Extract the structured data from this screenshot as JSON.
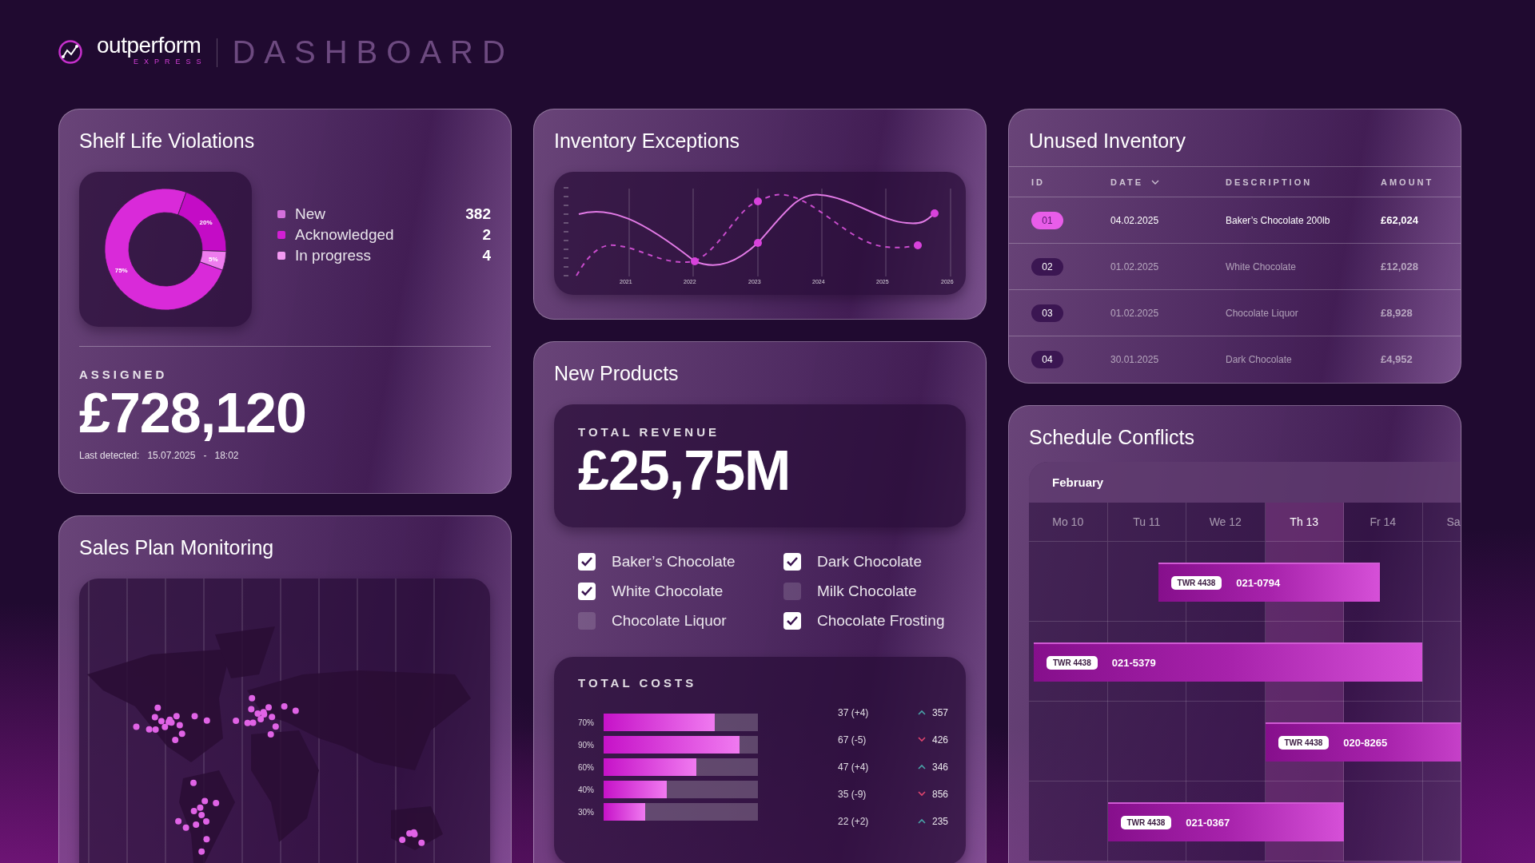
{
  "header": {
    "brand": "outperform",
    "brand_sub": "EXPRESS",
    "title": "DASHBOARD"
  },
  "shelf_life": {
    "title": "Shelf Life Violations",
    "chart_data": {
      "type": "donut",
      "values": [
        75,
        20,
        5
      ],
      "value_labels": [
        "75%",
        "20%",
        "5%"
      ]
    },
    "legend": [
      {
        "label": "New",
        "count": "382",
        "color": "#d46fdc"
      },
      {
        "label": "Acknowledged",
        "count": "2",
        "color": "#d21fd4"
      },
      {
        "label": "In progress",
        "count": "4",
        "color": "#f39af3"
      }
    ],
    "assigned_label": "ASSIGNED",
    "assigned_value": "£728,120",
    "detected_label": "Last detected:",
    "detected_date": "15.07.2025",
    "detected_sep": "-",
    "detected_time": "18:02"
  },
  "sales_plan": {
    "title": "Sales Plan Monitoring"
  },
  "inventory_exceptions": {
    "title": "Inventory Exceptions",
    "x_labels": [
      "2021",
      "2022",
      "2023",
      "2024",
      "2025",
      "2026"
    ]
  },
  "new_products": {
    "title": "New Products",
    "revenue_label": "TOTAL REVENUE",
    "revenue_value": "£25,75M",
    "products": [
      {
        "label": "Baker’s Chocolate",
        "checked": true
      },
      {
        "label": "Dark Chocolate",
        "checked": true
      },
      {
        "label": "White Chocolate",
        "checked": true
      },
      {
        "label": "Milk Chocolate",
        "checked": false
      },
      {
        "label": "Chocolate Liquor",
        "checked": false
      },
      {
        "label": "Chocolate Frosting",
        "checked": true
      }
    ],
    "costs": {
      "title": "TOTAL COSTS",
      "bars": [
        {
          "label": "70%",
          "level": 0.72
        },
        {
          "label": "90%",
          "level": 0.88
        },
        {
          "label": "60%",
          "level": 0.6
        },
        {
          "label": "40%",
          "level": 0.41
        },
        {
          "label": "30%",
          "level": 0.27
        }
      ],
      "stats": [
        {
          "value": "37 (+4)",
          "kind": "up",
          "total": "357"
        },
        {
          "value": "67 (-5)",
          "kind": "down",
          "total": "426"
        },
        {
          "value": "47 (+4)",
          "kind": "up",
          "total": "346"
        },
        {
          "value": "35 (-9)",
          "kind": "down",
          "total": "856"
        },
        {
          "value": "22 (+2)",
          "kind": "up",
          "total": "235"
        }
      ]
    }
  },
  "unused_inventory": {
    "title": "Unused Inventory",
    "columns": [
      {
        "label": "ID",
        "sortable": false
      },
      {
        "label": "DATE",
        "sortable": true
      },
      {
        "label": "DESCRIPTION",
        "sortable": false
      },
      {
        "label": "AMOUNT",
        "sortable": false
      }
    ],
    "rows": [
      {
        "id": "01",
        "date": "04.02.2025",
        "description": "Baker’s Chocolate 200lb",
        "amount": "£62,024",
        "selected": true
      },
      {
        "id": "02",
        "date": "01.02.2025",
        "description": "White Chocolate",
        "amount": "£12,028",
        "selected": false
      },
      {
        "id": "03",
        "date": "01.02.2025",
        "description": "Chocolate Liquor",
        "amount": "£8,928",
        "selected": false
      },
      {
        "id": "04",
        "date": "30.01.2025",
        "description": "Dark Chocolate",
        "amount": "£4,952",
        "selected": false
      }
    ]
  },
  "schedule": {
    "title": "Schedule Conflicts",
    "month": "February",
    "days": [
      {
        "label": "Mo 10",
        "selected": false
      },
      {
        "label": "Tu 11",
        "selected": false
      },
      {
        "label": "We 12",
        "selected": false
      },
      {
        "label": "Th 13",
        "selected": true
      },
      {
        "label": "Fr 14",
        "selected": false
      },
      {
        "label": "Sa",
        "selected": false
      }
    ],
    "events": [
      {
        "tag": "TWR 4438",
        "code": "021-0794"
      },
      {
        "tag": "TWR 4438",
        "code": "021-5379"
      },
      {
        "tag": "TWR 4438",
        "code": "020-8265"
      },
      {
        "tag": "TWR 4438",
        "code": "021-0367"
      }
    ]
  }
}
